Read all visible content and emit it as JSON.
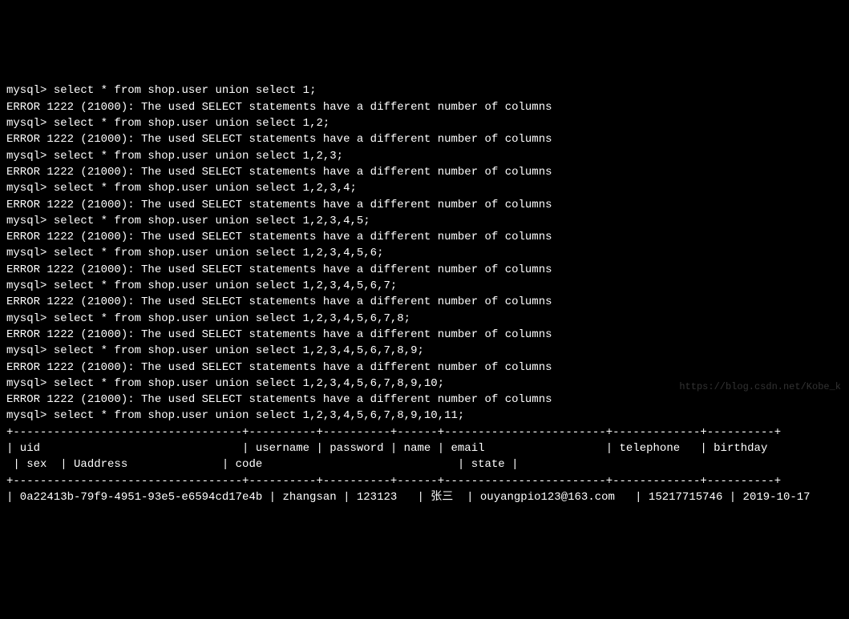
{
  "prompt": "mysql> ",
  "error_msg": "ERROR 1222 (21000): The used SELECT statements have a different number of columns",
  "queries": [
    "select * from shop.user union select 1;",
    "select * from shop.user union select 1,2;",
    "select * from shop.user union select 1,2,3;",
    "select * from shop.user union select 1,2,3,4;",
    "select * from shop.user union select 1,2,3,4,5;",
    "select * from shop.user union select 1,2,3,4,5,6;",
    "select * from shop.user union select 1,2,3,4,5,6,7;",
    "select * from shop.user union select 1,2,3,4,5,6,7,8;",
    "select * from shop.user union select 1,2,3,4,5,6,7,8,9;",
    "select * from shop.user union select 1,2,3,4,5,6,7,8,9,10;"
  ],
  "final_query": "select * from shop.user union select 1,2,3,4,5,6,7,8,9,10,11;",
  "table": {
    "separator_line": "+----------------------------------+----------+----------+------+------------------------+-------------+----------+",
    "header_line1": "| uid                              | username | password | name | email                  | telephone   | birthday ",
    "header_line2": " | sex  | Uaddress              | code                             | state |",
    "data_line": "| 0a22413b-79f9-4951-93e5-e6594cd17e4b | zhangsan | 123123   | 张三  | ouyangpio123@163.com   | 15217715746 | 2019-10-17"
  },
  "watermark": "https://blog.csdn.net/Kobe_k"
}
